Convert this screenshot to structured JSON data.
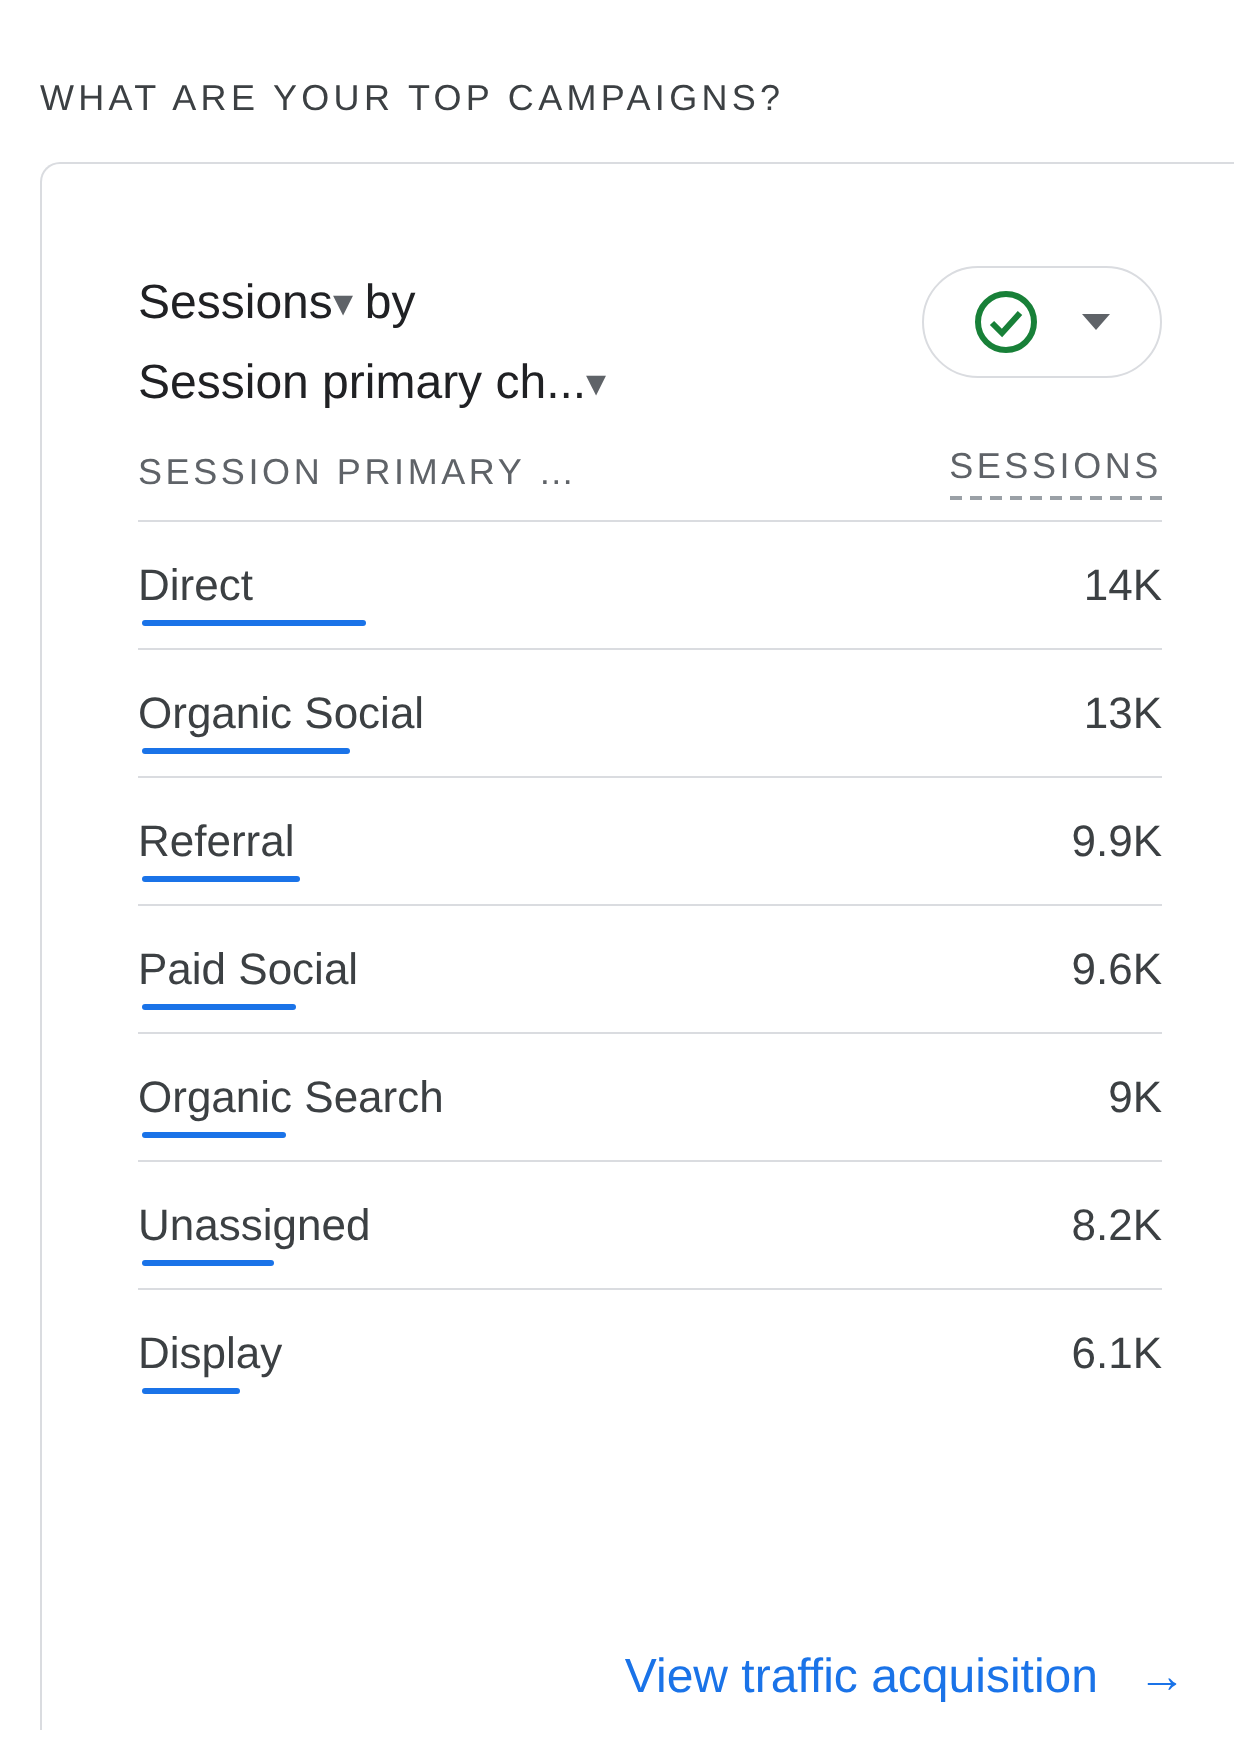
{
  "section_title": "WHAT ARE YOUR TOP CAMPAIGNS?",
  "card": {
    "metric": "Sessions",
    "metric_caret": "▾",
    "by": "by",
    "dimension": "Session primary ch...",
    "dimension_caret": "▾",
    "status_button": {
      "checked": true
    },
    "table": {
      "columns": [
        "SESSION PRIMARY …",
        "SESSIONS"
      ],
      "rows": [
        {
          "label": "Direct",
          "value": "14K"
        },
        {
          "label": "Organic Social",
          "value": "13K"
        },
        {
          "label": "Referral",
          "value": "9.9K"
        },
        {
          "label": "Paid Social",
          "value": "9.6K"
        },
        {
          "label": "Organic Search",
          "value": "9K"
        },
        {
          "label": "Unassigned",
          "value": "8.2K"
        },
        {
          "label": "Display",
          "value": "6.1K"
        }
      ]
    },
    "link": {
      "label": "View traffic acquisition",
      "arrow": "→"
    }
  }
}
